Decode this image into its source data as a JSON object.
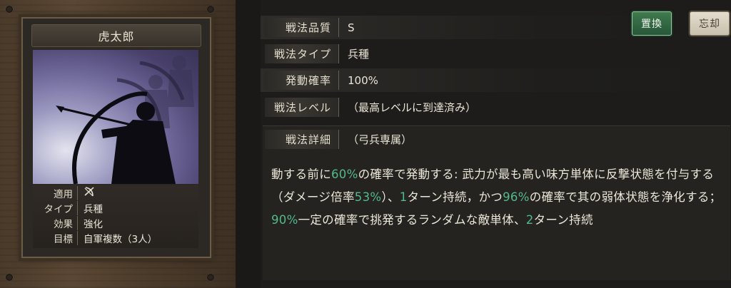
{
  "card": {
    "name": "虎太郎",
    "info": [
      {
        "key": "適用",
        "value": "",
        "icon": "crossed-bow-icon"
      },
      {
        "key": "タイプ",
        "value": "兵種"
      },
      {
        "key": "効果",
        "value": "強化"
      },
      {
        "key": "目標",
        "value": "自軍複数（3人）"
      }
    ]
  },
  "tactic": {
    "quality": {
      "label": "戦法品質",
      "value": "S"
    },
    "type": {
      "label": "戦法タイプ",
      "value": "兵種"
    },
    "rate": {
      "label": "発動確率",
      "value": "100%"
    },
    "level": {
      "label": "戦法レベル",
      "value": "（最高レベルに到達済み）"
    },
    "detail": {
      "label": "戦法詳細",
      "value": "（弓兵専属）"
    }
  },
  "description": {
    "parts": [
      {
        "text": "動する前に",
        "hl": false
      },
      {
        "text": "60%",
        "hl": true
      },
      {
        "text": "の確率で発動する: 武力が最も高い味方単体に反撃状態を付与する（ダメージ倍率",
        "hl": false
      },
      {
        "text": "53%",
        "hl": true
      },
      {
        "text": "）、",
        "hl": false
      },
      {
        "text": "1",
        "hl": true
      },
      {
        "text": "ターン持続，かつ",
        "hl": false
      },
      {
        "text": "96%",
        "hl": true
      },
      {
        "text": "の確率で其の弱体状態を浄化する；",
        "hl": false
      },
      {
        "text": "90%",
        "hl": true
      },
      {
        "text": "一定の確率で挑発するランダムな敵単体、",
        "hl": false
      },
      {
        "text": "2",
        "hl": true
      },
      {
        "text": "ターン持続",
        "hl": false
      }
    ],
    "highlight_color": "#53b98a"
  },
  "buttons": {
    "replace": "置換",
    "forget": "忘却"
  }
}
